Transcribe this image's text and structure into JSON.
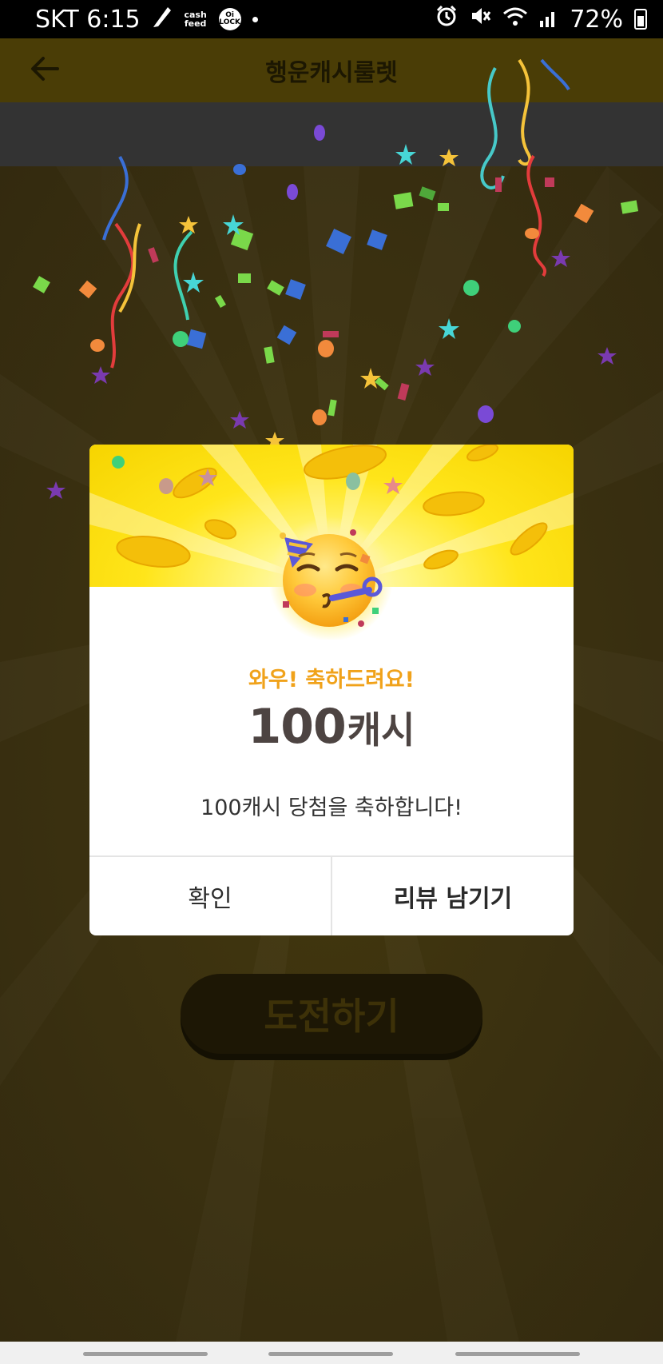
{
  "status_bar": {
    "carrier_time": "SKT 6:15",
    "icons": [
      "pen-notification-icon",
      "cashfeed-icon",
      "oilock-icon",
      "more-dot-icon",
      "alarm-icon",
      "mute-icon",
      "wifi-icon",
      "signal-icon"
    ],
    "cashfeed_label": "cash feed",
    "oilock_label": "Oi LOCK",
    "battery": "72%"
  },
  "app": {
    "title": "행운캐시룰렛",
    "challenge_button": "도전하기"
  },
  "dialog": {
    "subtitle": "와우! 축하드려요!",
    "amount": "100",
    "amount_unit": "캐시",
    "message": "100캐시 당첨을 축하합니다!",
    "confirm_label": "확인",
    "review_label": "리뷰 남기기"
  },
  "colors": {
    "accent_yellow": "#ffe51a",
    "subtitle_orange": "#f0a21a",
    "amount_text": "#4d4442"
  }
}
